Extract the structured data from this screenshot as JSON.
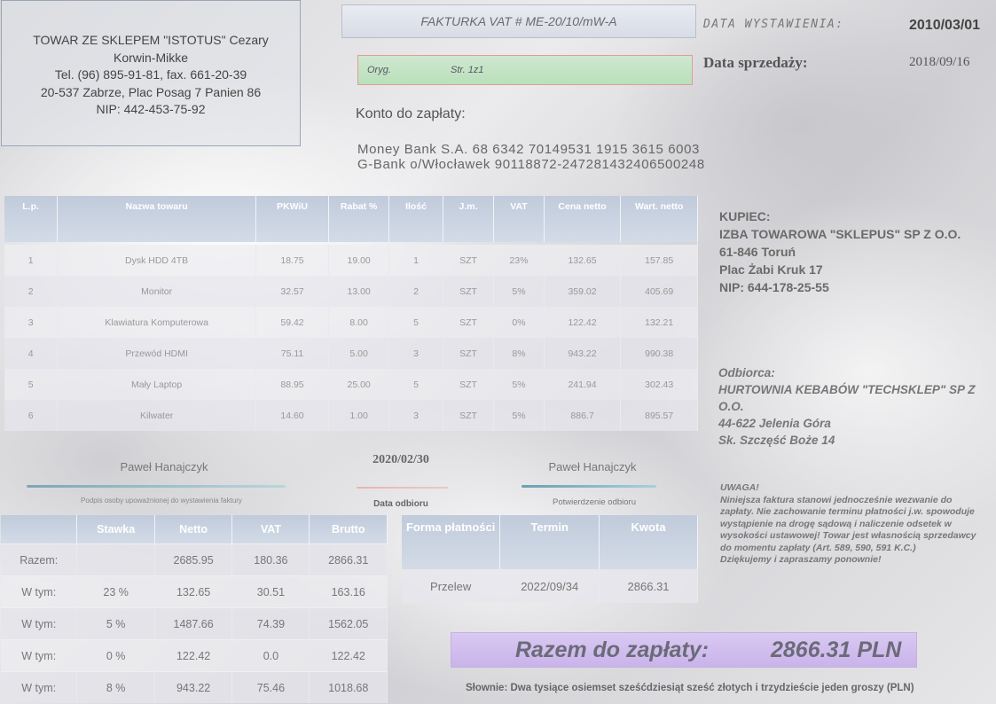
{
  "seller": {
    "name": "TOWAR ZE SKLEPEM \"ISTOTUS\" Cezary Korwin-Mikke",
    "phone": "Tel. (96) 895-91-81, fax. 661-20-39",
    "address": "20-537 Zabrze, Plac Posag 7 Panien 86",
    "nip": "NIP: 442-453-75-92"
  },
  "invoice": {
    "title": "FAKTURKA VAT # ME-20/10/mW-A",
    "original": "Oryg.",
    "page": "Str. 1z1",
    "issue_date_label": "DATA WYSTAWIENIA:",
    "issue_date": "2010/03/01",
    "sale_date_label": "Data sprzedaży:",
    "sale_date": "2018/09/16"
  },
  "account": {
    "label": "Konto do zapłaty:",
    "line1": "Money Bank S.A. 68 6342 70149531 1915 3615 6003",
    "line2": "G-Bank  o/Włocławek 90118872-247281432406500248"
  },
  "items": {
    "headers": [
      "L.p.",
      "Nazwa towaru",
      "PKWiU",
      "Rabat %",
      "Ilość",
      "J.m.",
      "VAT",
      "Cena netto",
      "Wart. netto"
    ],
    "rows": [
      [
        "1",
        "Dysk HDD 4TB",
        "18.75",
        "19.00",
        "1",
        "SZT",
        "23%",
        "132.65",
        "157.85"
      ],
      [
        "2",
        "Monitor",
        "32.57",
        "13.00",
        "2",
        "SZT",
        "5%",
        "359.02",
        "405.69"
      ],
      [
        "3",
        "Klawiatura Komputerowa",
        "59.42",
        "8.00",
        "5",
        "SZT",
        "0%",
        "122.42",
        "132.21"
      ],
      [
        "4",
        "Przewód HDMI",
        "75.11",
        "5.00",
        "3",
        "SZT",
        "8%",
        "943.22",
        "990.38"
      ],
      [
        "5",
        "Mały Laptop",
        "88.95",
        "25.00",
        "5",
        "SZT",
        "5%",
        "241.94",
        "302.43"
      ],
      [
        "6",
        "Kilwater",
        "14.60",
        "1.00",
        "3",
        "SZT",
        "5%",
        "886.7",
        "895.57"
      ]
    ]
  },
  "buyer": {
    "label": "KUPIEC:",
    "name": "IZBA TOWAROWA \"SKLEPUS\" SP Z O.O.",
    "city": "61-846 Toruń",
    "street": "Plac Żabi Kruk 17",
    "nip": "NIP: 644-178-25-55"
  },
  "recipient": {
    "label": "Odbiorca:",
    "name": "HURTOWNIA KEBABÓW \"TECHSKLEP\" SP Z O.O.",
    "city": "44-622 Jelenia Góra",
    "street": "Sk. Szczęść Boże 14"
  },
  "signatures": {
    "issuer_name": "Paweł Hanajczyk",
    "issuer_caption": "Podpis osoby upoważnionej do wystawienia faktury",
    "receipt_date": "2020/02/30",
    "receipt_date_caption": "Data odbioru",
    "receiver_name": "Paweł Hanajczyk",
    "receiver_caption": "Potwierdzenie odbioru"
  },
  "totals": {
    "headers": [
      "",
      "Stawka",
      "Netto",
      "VAT",
      "Brutto"
    ],
    "rows": [
      [
        "Razem:",
        "",
        "2685.95",
        "180.36",
        "2866.31"
      ],
      [
        "W tym:",
        "23 %",
        "132.65",
        "30.51",
        "163.16"
      ],
      [
        "W tym:",
        "5 %",
        "1487.66",
        "74.39",
        "1562.05"
      ],
      [
        "W tym:",
        "0 %",
        "122.42",
        "0.0",
        "122.42"
      ],
      [
        "W tym:",
        "8 %",
        "943.22",
        "75.46",
        "1018.68"
      ]
    ]
  },
  "payment": {
    "headers": [
      "Forma płatności",
      "Termin",
      "Kwota"
    ],
    "row": [
      "Przelew",
      "2022/09/34",
      "2866.31"
    ]
  },
  "note": {
    "title": "UWAGA!",
    "text": "Niniejsza  faktura stanowi jednocześnie wezwanie do zapłaty. Nie zachowanie  terminu płatności j.w. spowoduje  wystąpienie na drogę sądową i naliczenie  odsetek w wysokości ustawowej!  Towar jest własnością sprzedawcy do momentu zapłaty (Art. 589, 590, 591 K.C.)",
    "thanks": "Dziękujemy i zapraszamy ponownie!"
  },
  "summary": {
    "label": "Razem do zapłaty:",
    "amount": "2866.31 PLN",
    "words_label": "Słownie:",
    "words": "Dwa tysiące osiemset sześćdziesiąt sześć złotych  i trzydzieście jeden groszy (PLN)"
  },
  "colors": {
    "header_blue": "#c0cbdb",
    "title_box": "#e9ebf2",
    "original_box": "#c2e4c4",
    "total_box": "#d3c1ef"
  }
}
